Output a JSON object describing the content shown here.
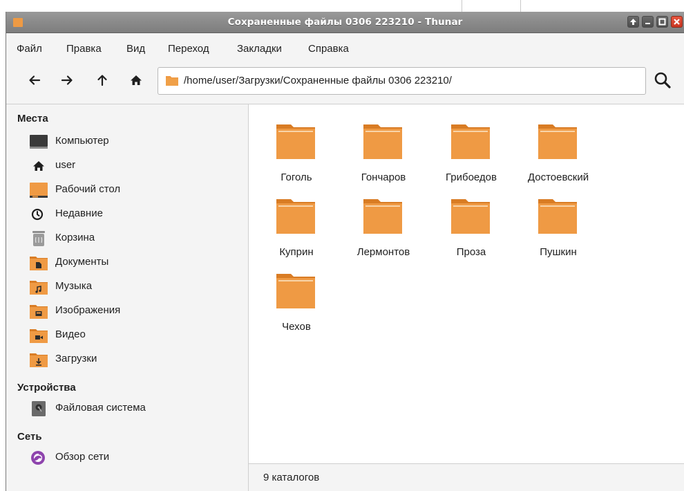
{
  "window": {
    "title": "Сохраненные файлы 0306 223210 - Thunar",
    "buttons": [
      "maximize-up",
      "minimize",
      "maximize",
      "close"
    ]
  },
  "menu": [
    "Файл",
    "Правка",
    "Вид",
    "Переход",
    "Закладки",
    "Справка"
  ],
  "toolbar": {
    "icons": [
      "back-arrow-icon",
      "forward-arrow-icon",
      "up-arrow-icon",
      "home-icon",
      "search-icon"
    ],
    "location_path": "/home/user/Загрузки/Сохраненные файлы 0306 223210/"
  },
  "sidebar": {
    "places_header": "Места",
    "places": [
      {
        "label": "Компьютер",
        "icon": "computer-icon"
      },
      {
        "label": "user",
        "icon": "home-icon"
      },
      {
        "label": "Рабочий стол",
        "icon": "desktop-icon"
      },
      {
        "label": "Недавние",
        "icon": "clock-icon"
      },
      {
        "label": "Корзина",
        "icon": "trash-icon"
      },
      {
        "label": "Документы",
        "icon": "documents-folder-icon"
      },
      {
        "label": "Музыка",
        "icon": "music-folder-icon"
      },
      {
        "label": "Изображения",
        "icon": "pictures-folder-icon"
      },
      {
        "label": "Видео",
        "icon": "video-folder-icon"
      },
      {
        "label": "Загрузки",
        "icon": "downloads-folder-icon"
      }
    ],
    "devices_header": "Устройства",
    "devices": [
      {
        "label": "Файловая система",
        "icon": "drive-icon"
      }
    ],
    "network_header": "Сеть",
    "network": [
      {
        "label": "Обзор сети",
        "icon": "network-icon"
      }
    ]
  },
  "files": [
    {
      "name": "Гоголь"
    },
    {
      "name": "Гончаров"
    },
    {
      "name": "Грибоедов"
    },
    {
      "name": "Достоевский"
    },
    {
      "name": "Куприн"
    },
    {
      "name": "Лермонтов"
    },
    {
      "name": "Проза"
    },
    {
      "name": "Пушкин"
    },
    {
      "name": "Чехов"
    }
  ],
  "status": "9 каталогов",
  "colors": {
    "folder": "#ef9a44",
    "folder_dark": "#d97c24",
    "titlebar": "#8a8a8a",
    "close": "#d9432c",
    "network": "#8e44ad"
  }
}
